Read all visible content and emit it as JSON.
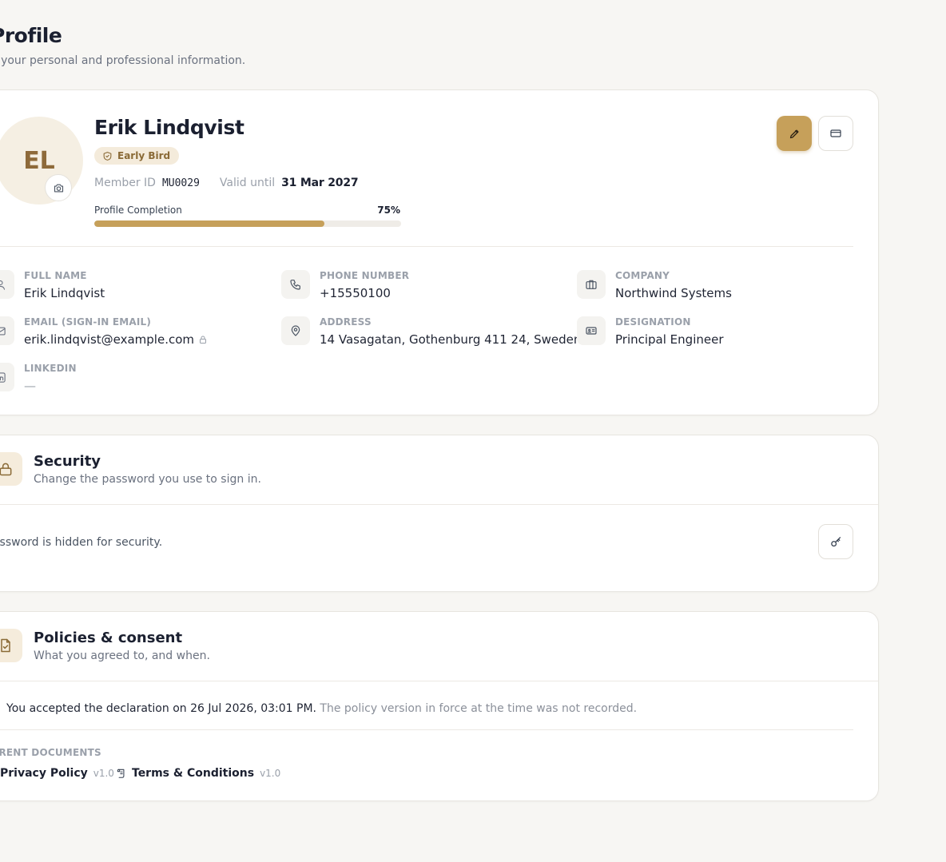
{
  "page": {
    "title": "Profile",
    "subtitle": "e your personal and professional information."
  },
  "profile": {
    "initials": "EL",
    "name": "Erik Lindqvist",
    "badge": "Early Bird",
    "member_id_label": "Member ID",
    "member_id": "MU0029",
    "valid_until_label": "Valid until",
    "valid_until": "31 Mar 2027",
    "completion_label": "Profile Completion",
    "completion_pct_text": "75%",
    "completion_fraction": 0.75,
    "accent_color": "#c6a05a"
  },
  "fields": {
    "full_name": {
      "label": "FULL NAME",
      "value": "Erik Lindqvist"
    },
    "phone": {
      "label": "PHONE NUMBER",
      "value": "+15550100"
    },
    "company": {
      "label": "COMPANY",
      "value": "Northwind Systems"
    },
    "email": {
      "label": "EMAIL (SIGN-IN EMAIL)",
      "value": "erik.lindqvist@example.com"
    },
    "address": {
      "label": "ADDRESS",
      "value": "14 Vasagatan, Gothenburg 411 24, Sweden"
    },
    "designation": {
      "label": "DESIGNATION",
      "value": "Principal Engineer"
    },
    "linkedin": {
      "label": "LINKEDIN",
      "value": "—"
    }
  },
  "security": {
    "title": "Security",
    "subtitle": "Change the password you use to sign in.",
    "hidden_text": "ur password is hidden for security."
  },
  "policies": {
    "title": "Policies & consent",
    "subtitle": "What you agreed to, and when.",
    "consent_text": "You accepted the declaration on 26 Jul 2026, 03:01 PM.",
    "consent_note": " The policy version in force at the time was not recorded.",
    "docs_label": "RRENT DOCUMENTS",
    "documents": [
      {
        "name": "Privacy Policy",
        "version": "v1.0"
      },
      {
        "name": "Terms & Conditions",
        "version": "v1.0"
      }
    ]
  }
}
